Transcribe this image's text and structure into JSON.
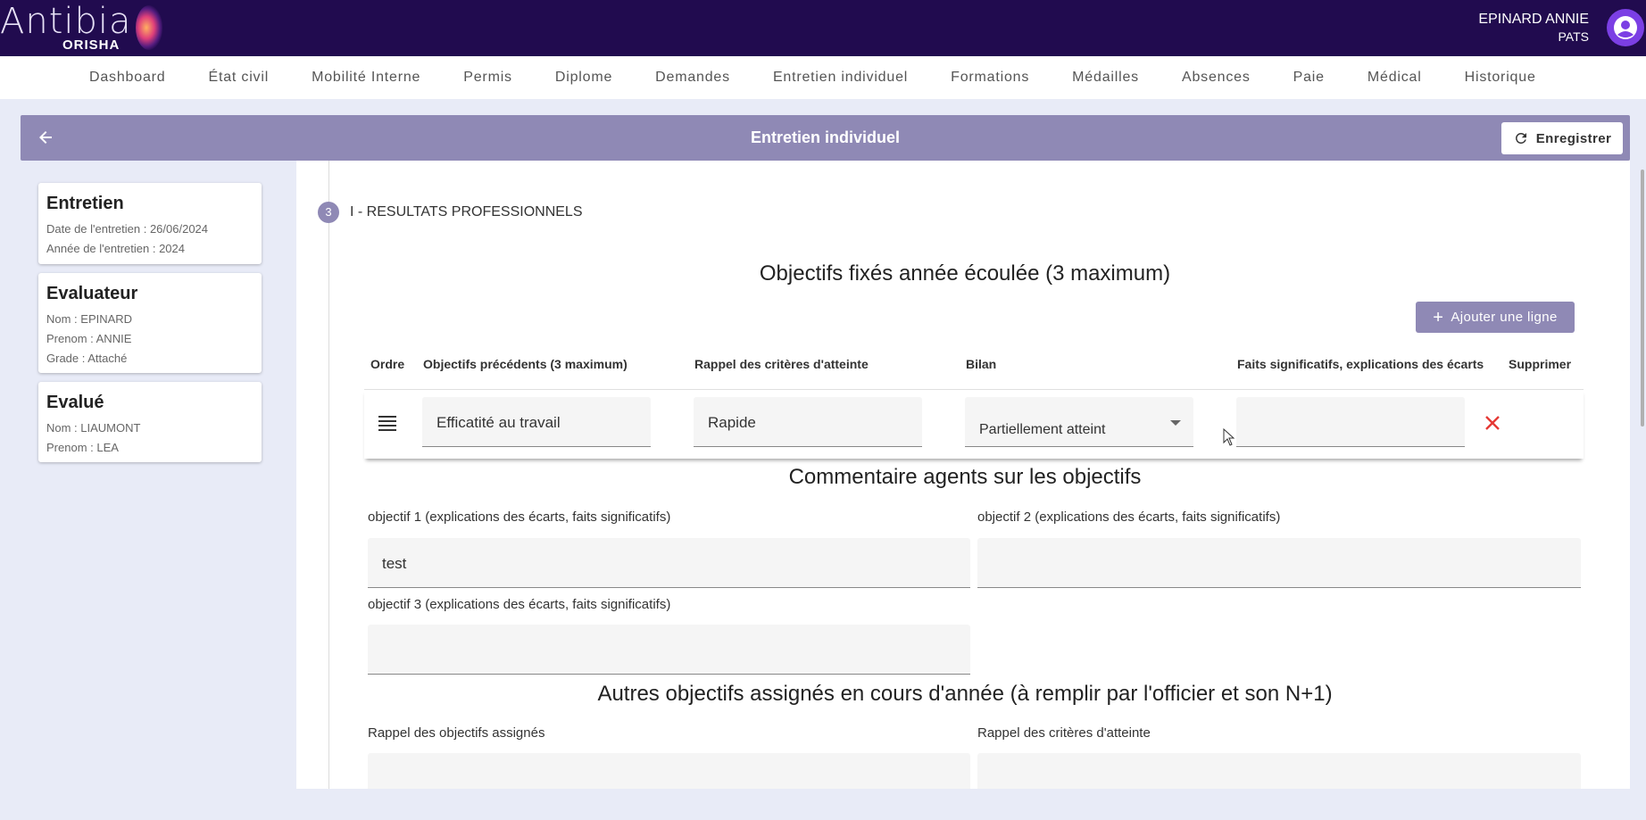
{
  "app": {
    "logo_main": "Antibia",
    "logo_sub": "ORISHA"
  },
  "user": {
    "name": "EPINARD ANNIE",
    "role": "PATS",
    "avatar_icon": "account-circle-icon"
  },
  "nav": [
    "Dashboard",
    "État civil",
    "Mobilité Interne",
    "Permis",
    "Diplome",
    "Demandes",
    "Entretien individuel",
    "Formations",
    "Médailles",
    "Absences",
    "Paie",
    "Médical",
    "Historique"
  ],
  "header": {
    "title": "Entretien individuel",
    "save_label": "Enregistrer"
  },
  "cards": {
    "entretien": {
      "title": "Entretien",
      "date": "Date de l'entretien : 26/06/2024",
      "annee": "Année de l'entretien : 2024"
    },
    "evaluateur": {
      "title": "Evaluateur",
      "nom": "Nom : EPINARD",
      "prenom": "Prenom : ANNIE",
      "grade": "Grade : Attaché"
    },
    "evalue": {
      "title": "Evalué",
      "nom": "Nom : LIAUMONT",
      "prenom": "Prenom : LEA"
    }
  },
  "step": {
    "number": "3",
    "label": "I - RESULTATS PROFESSIONNELS"
  },
  "objectifs": {
    "title": "Objectifs fixés année écoulée (3 maximum)",
    "add_label": "Ajouter une ligne",
    "columns": [
      "Ordre",
      "Objectifs précédents (3 maximum)",
      "Rappel des critères d'atteinte",
      "Bilan",
      "Faits significatifs, explications des écarts",
      "Supprimer"
    ],
    "rows": [
      {
        "objectif": "Efficatité au travail",
        "critere": "Rapide",
        "bilan": "Partiellement atteint",
        "faits": ""
      }
    ]
  },
  "commentaires": {
    "title": "Commentaire agents sur les objectifs",
    "obj1_label": "objectif 1 (explications des écarts, faits significatifs)",
    "obj1_value": "test",
    "obj2_label": "objectif 2 (explications des écarts, faits significatifs)",
    "obj2_value": "",
    "obj3_label": "objectif 3 (explications des écarts, faits significatifs)",
    "obj3_value": ""
  },
  "autres": {
    "title": "Autres objectifs assignés en cours d'année (à remplir par l'officier et son N+1)",
    "rappel_objectifs_label": "Rappel des objectifs assignés",
    "rappel_criteres_label": "Rappel des critères d'atteinte"
  },
  "colors": {
    "topbar": "#210b4f",
    "accent": "#8f89b5",
    "avatar": "#7b3fe4",
    "delete": "#e53935",
    "background": "#e8ebf7"
  }
}
